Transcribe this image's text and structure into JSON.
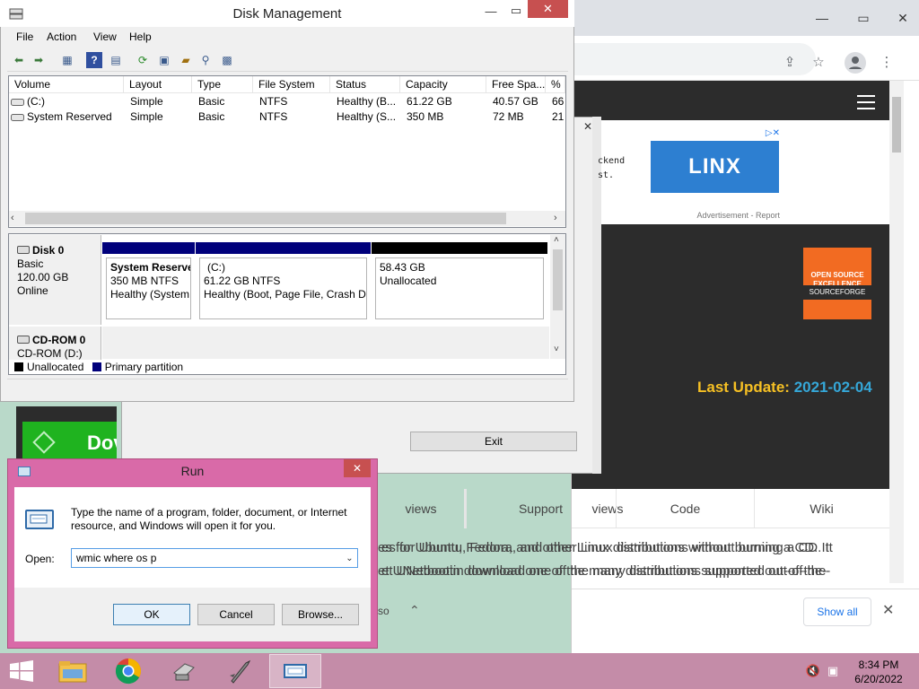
{
  "browser": {
    "advert": {
      "brand": "LINX",
      "label": "Advertisement - Report",
      "snippet": [
        "ckend",
        "st."
      ]
    },
    "badge": {
      "line1": "OPEN SOURCE",
      "line2": "EXCELLENCE",
      "ribbon": "SOURCEFORGE"
    },
    "last_update": {
      "label": "Last Update:",
      "date": "2021-02-04"
    },
    "download_tile": "Dov",
    "tabs": [
      "views",
      "Support",
      "Code",
      "Wiki"
    ],
    "description": [
      "es for Ubuntu, Fedora, and other Linux distributions without burning a CD. It",
      "et UNetbootin download one of the many distributions supported out-of-the-"
    ],
    "download_bar": {
      "item_fragment": "so",
      "show_all": "Show all"
    }
  },
  "exit_dialog": {
    "exit_label": "Exit"
  },
  "disk_mgmt": {
    "title": "Disk Management",
    "menu": [
      "File",
      "Action",
      "View",
      "Help"
    ],
    "columns": [
      "Volume",
      "Layout",
      "Type",
      "File System",
      "Status",
      "Capacity",
      "Free Spa...",
      "% F"
    ],
    "rows": [
      [
        "(C:)",
        "Simple",
        "Basic",
        "NTFS",
        "Healthy (B...",
        "61.22 GB",
        "40.57 GB",
        "66"
      ],
      [
        "System Reserved",
        "Simple",
        "Basic",
        "NTFS",
        "Healthy (S...",
        "350 MB",
        "72 MB",
        "21"
      ]
    ],
    "disk0": {
      "name": "Disk 0",
      "type": "Basic",
      "size": "120.00 GB",
      "state": "Online"
    },
    "partitions": [
      {
        "name": "System Reserve",
        "size": "350 MB NTFS",
        "status": "Healthy (System,"
      },
      {
        "name": "(C:)",
        "size": "61.22 GB NTFS",
        "status": "Healthy (Boot, Page File, Crash Du"
      },
      {
        "name": "",
        "size": "58.43 GB",
        "status": "Unallocated"
      }
    ],
    "cdrom": {
      "name": "CD-ROM 0",
      "sub": "CD-ROM (D:)"
    },
    "legend": {
      "unallocated": "Unallocated",
      "primary": "Primary partition"
    },
    "colors": {
      "primary": "#00007b",
      "unallocated": "#000000"
    }
  },
  "run": {
    "title": "Run",
    "description": "Type the name of a program, folder, document, or Internet resource, and Windows will open it for you.",
    "open_label": "Open:",
    "input_value": "wmic where os p",
    "ok": "OK",
    "cancel": "Cancel",
    "browse": "Browse..."
  },
  "taskbar": {
    "time": "8:34 PM",
    "date": "6/20/2022",
    "apps": [
      "file-explorer-icon",
      "chrome-icon",
      "disk-tool-icon",
      "unetbootin-icon",
      "disk-management-icon"
    ]
  }
}
